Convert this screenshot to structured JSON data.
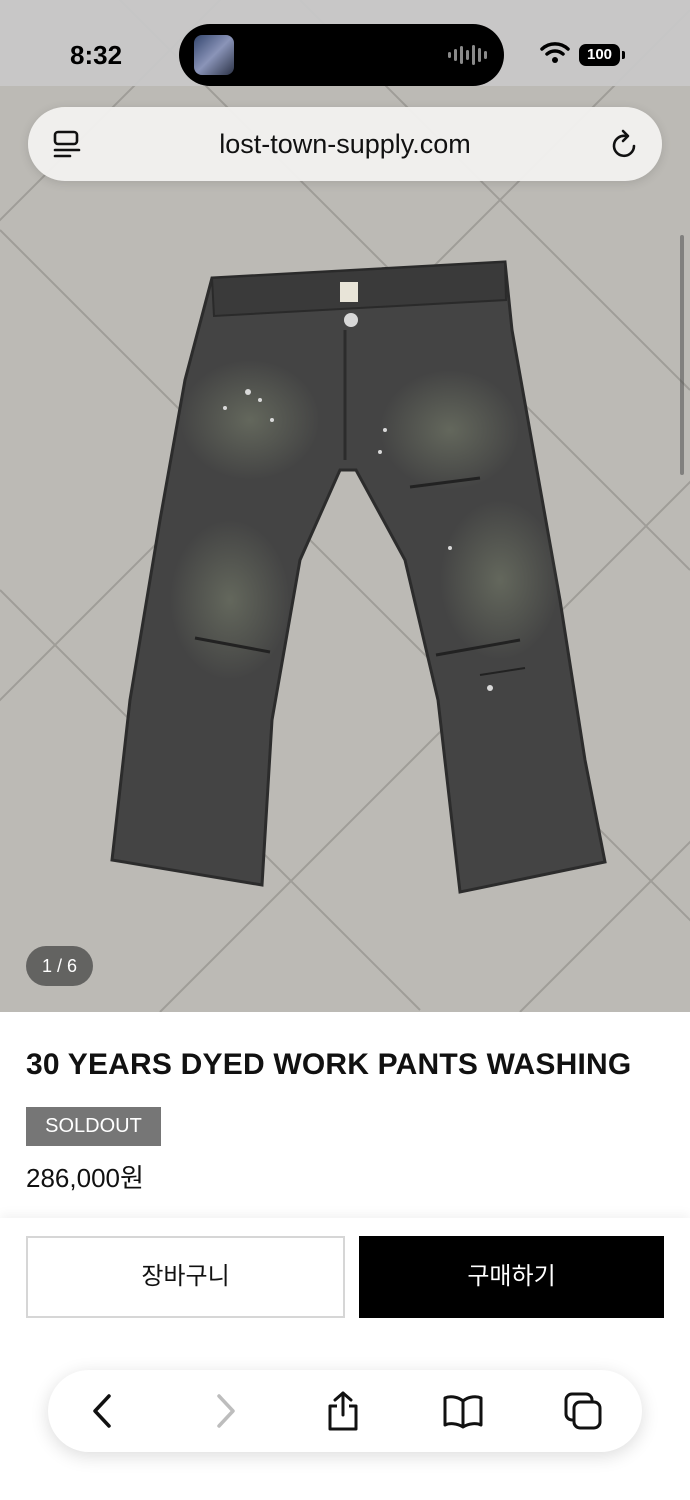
{
  "status_bar": {
    "time": "8:32",
    "battery": "100",
    "icons": [
      "music-artwork-icon",
      "audio-waveform-icon",
      "wifi-icon",
      "battery-icon"
    ]
  },
  "browser": {
    "url": "lost-town-supply.com",
    "icons": [
      "tab-menu-icon",
      "reload-icon"
    ]
  },
  "gallery": {
    "counter": "1 / 6"
  },
  "product": {
    "title": "30 YEARS DYED WORK PANTS WASHING",
    "badge": "SOLDOUT",
    "price": "286,000원"
  },
  "actions": {
    "cart_label": "장바구니",
    "buy_label": "구매하기"
  },
  "toolbar": {
    "icons": [
      "back-icon",
      "forward-icon",
      "share-icon",
      "bookmarks-icon",
      "tabs-icon"
    ]
  },
  "colors": {
    "buy_button": "#000000",
    "soldout_badge": "#767676",
    "floor": "#b9b7b2",
    "pants": "#3f3f3f"
  }
}
